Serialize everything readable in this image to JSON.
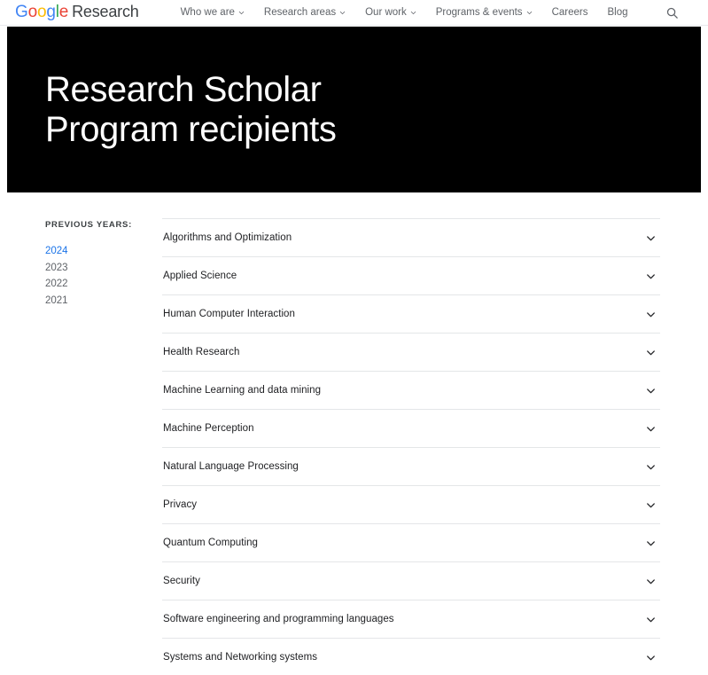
{
  "header": {
    "brand": {
      "logo_letters": [
        {
          "ch": "G",
          "color": "#4285F4"
        },
        {
          "ch": "o",
          "color": "#EA4335"
        },
        {
          "ch": "o",
          "color": "#FBBC05"
        },
        {
          "ch": "g",
          "color": "#4285F4"
        },
        {
          "ch": "l",
          "color": "#34A853"
        },
        {
          "ch": "e",
          "color": "#EA4335"
        }
      ],
      "suffix": "Research"
    },
    "nav": [
      {
        "label": "Who we are",
        "has_caret": true
      },
      {
        "label": "Research areas",
        "has_caret": true
      },
      {
        "label": "Our work",
        "has_caret": true
      },
      {
        "label": "Programs & events",
        "has_caret": true
      },
      {
        "label": "Careers",
        "has_caret": false
      },
      {
        "label": "Blog",
        "has_caret": false
      }
    ],
    "search_icon": "search-icon"
  },
  "hero": {
    "title": "Research Scholar Program recipients",
    "background": "#000000",
    "text_color": "#ffffff"
  },
  "sidebar": {
    "label": "PREVIOUS YEARS:",
    "active_color": "#1a73e8",
    "years": [
      {
        "label": "2024",
        "active": true
      },
      {
        "label": "2023",
        "active": false
      },
      {
        "label": "2022",
        "active": false
      },
      {
        "label": "2021",
        "active": false
      }
    ]
  },
  "accordion": {
    "chevron_icon": "chevron-down-icon",
    "items": [
      {
        "label": "Algorithms and Optimization",
        "expanded": false
      },
      {
        "label": "Applied Science",
        "expanded": false
      },
      {
        "label": "Human Computer Interaction",
        "expanded": false
      },
      {
        "label": "Health Research",
        "expanded": false
      },
      {
        "label": "Machine Learning and data mining",
        "expanded": false
      },
      {
        "label": "Machine Perception",
        "expanded": false
      },
      {
        "label": "Natural Language Processing",
        "expanded": false
      },
      {
        "label": "Privacy",
        "expanded": false
      },
      {
        "label": "Quantum Computing",
        "expanded": false
      },
      {
        "label": "Security",
        "expanded": false
      },
      {
        "label": "Software engineering and programming languages",
        "expanded": false
      },
      {
        "label": "Systems and Networking systems",
        "expanded": false
      }
    ]
  }
}
